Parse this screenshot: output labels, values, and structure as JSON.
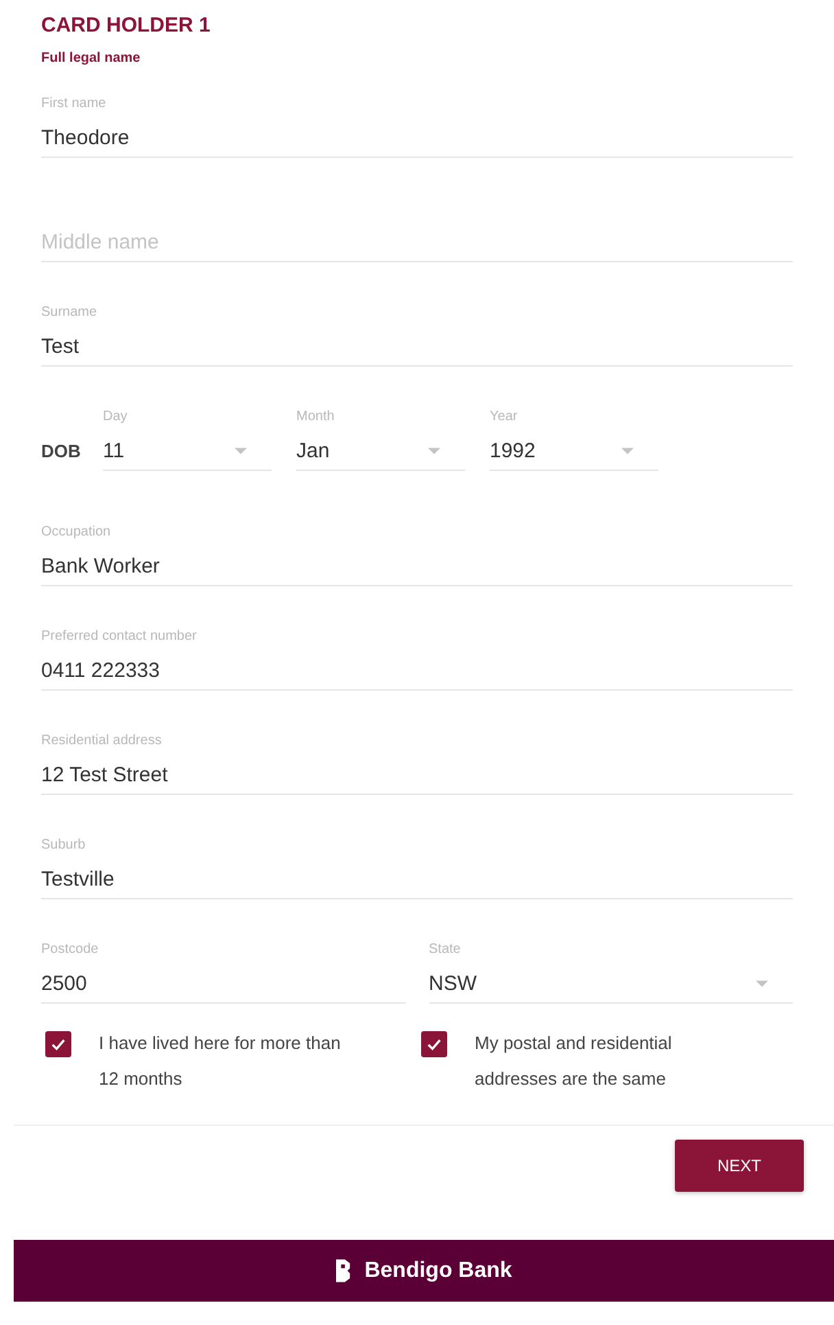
{
  "header": {
    "title": "CARD HOLDER 1",
    "subtitle": "Full legal name"
  },
  "fields": [
    {
      "kind": "text",
      "label": "First name",
      "value": "Theodore"
    },
    {
      "kind": "text",
      "placeholder": "Middle name"
    },
    {
      "kind": "text",
      "label": "Surname",
      "value": "Test"
    },
    {
      "kind": "date",
      "label": "DOB",
      "parts": [
        {
          "label": "Day",
          "value": "11"
        },
        {
          "label": "Month",
          "value": "Jan"
        },
        {
          "label": "Year",
          "value": "1992"
        }
      ]
    },
    {
      "kind": "text",
      "label": "Occupation",
      "value": "Bank Worker"
    },
    {
      "kind": "text",
      "label": "Preferred contact number",
      "value": "0411 222333"
    },
    {
      "kind": "text",
      "label": "Residential address",
      "value": "12 Test Street"
    },
    {
      "kind": "text",
      "label": "Suburb",
      "value": "Testville"
    },
    {
      "kind": "pair",
      "items": [
        {
          "kind": "text",
          "label": "Postcode",
          "value": "2500"
        },
        {
          "kind": "select",
          "label": "State",
          "value": "NSW"
        }
      ]
    }
  ],
  "checkboxes": [
    {
      "label": "I have lived here for more than 12 months",
      "checked": true
    },
    {
      "label": "My postal and residential addresses are the same",
      "checked": true
    }
  ],
  "next_button": "NEXT",
  "footer": {
    "brand": "Bendigo Bank"
  }
}
